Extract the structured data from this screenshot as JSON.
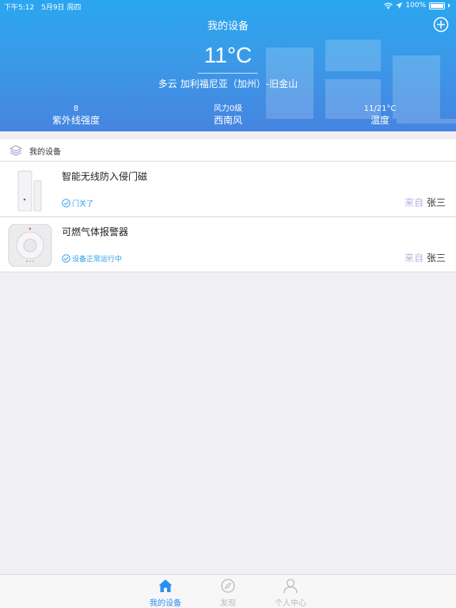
{
  "status_bar": {
    "time": "下午5:12",
    "date": "5月9日 周四",
    "battery": "100%"
  },
  "header": {
    "title": "我的设备",
    "add_icon": "plus-circle-icon"
  },
  "weather": {
    "temperature": "11°C",
    "location": "多云 加利福尼亚（加州）-旧金山",
    "stats": [
      {
        "value": "8",
        "label": "紫外线强度"
      },
      {
        "value": "风力0级",
        "label": "西南风"
      },
      {
        "value": "11/21°C",
        "label": "温度"
      }
    ]
  },
  "devices_section": {
    "title": "我的设备",
    "icon": "layers-icon"
  },
  "devices": [
    {
      "name": "智能无线防入侵门磁",
      "status": "门关了",
      "from_label": "来自",
      "from_name": "张三"
    },
    {
      "name": "可燃气体报警器",
      "status": "设备正常运行中",
      "from_label": "来自",
      "from_name": "张三"
    }
  ],
  "tabs": [
    {
      "label": "我的设备",
      "icon": "home-icon",
      "active": true
    },
    {
      "label": "发现",
      "icon": "compass-icon",
      "active": false
    },
    {
      "label": "个人中心",
      "icon": "person-icon",
      "active": false
    }
  ],
  "colors": {
    "accent": "#2a8ff0",
    "hero_top": "#2aa6f0",
    "hero_bottom": "#4684e0",
    "from_label": "#b8b3de",
    "status": "#2ea0ea"
  }
}
